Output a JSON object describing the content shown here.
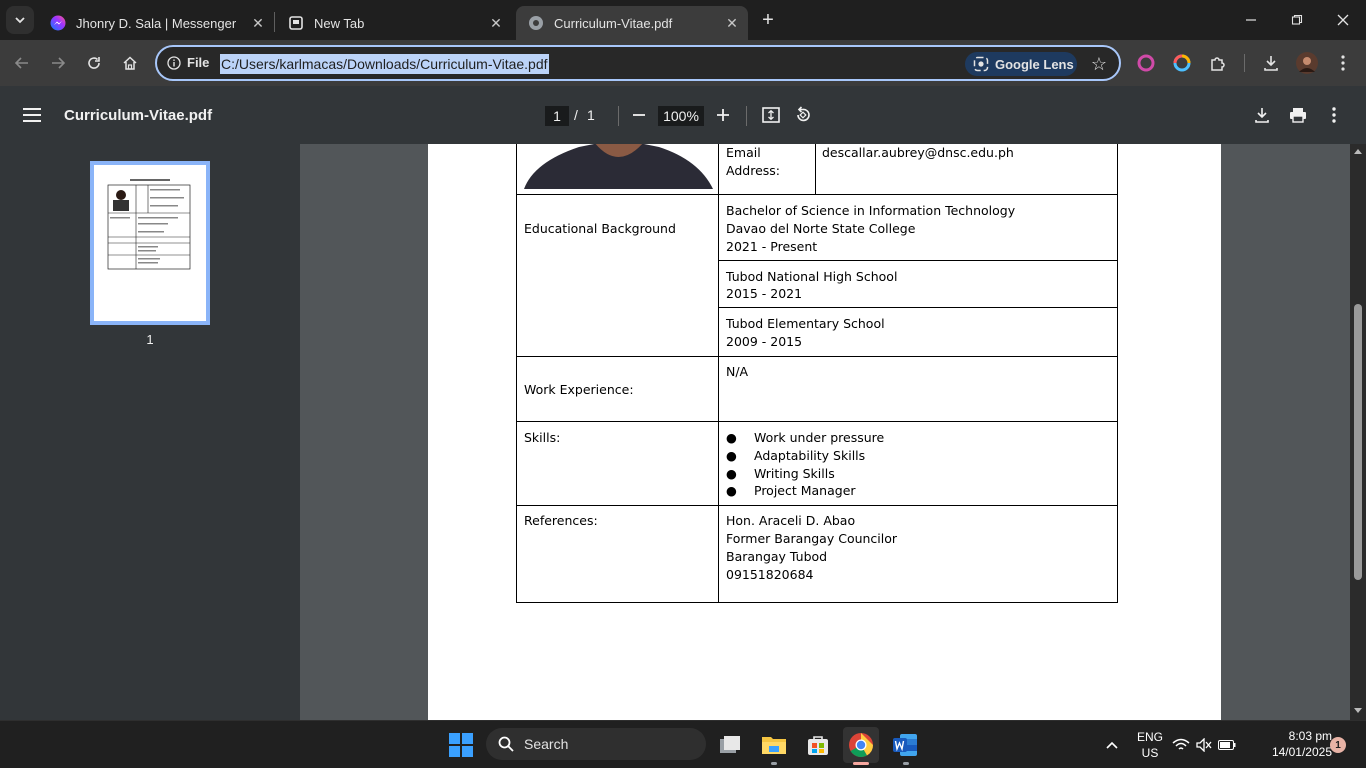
{
  "tabs": [
    {
      "title": "Jhonry D. Sala | Messenger",
      "icon": "messenger-icon"
    },
    {
      "title": "New Tab",
      "icon": "newtab-icon"
    },
    {
      "title": "Curriculum-Vitae.pdf",
      "icon": "globe-icon"
    }
  ],
  "address_bar": {
    "scheme_label": "File",
    "url": "C:/Users/karlmacas/Downloads/Curriculum-Vitae.pdf",
    "lens_label": "Google Lens"
  },
  "pdf_toolbar": {
    "title": "Curriculum-Vitae.pdf",
    "current_page": "1",
    "separator": "/",
    "total_pages": "1",
    "zoom": "100%"
  },
  "thumbnail": {
    "page_number": "1"
  },
  "document": {
    "email_label_1": "Email",
    "email_label_2": "Address:",
    "email_value": "descallar.aubrey@dnsc.edu.ph",
    "education_label": "Educational Background",
    "education": [
      {
        "line1": "Bachelor of Science in Information Technology",
        "line2": "Davao del Norte State College",
        "line3": "2021 - Present"
      },
      {
        "line1": "Tubod National High School",
        "line2": "2015 - 2021"
      },
      {
        "line1": "Tubod Elementary School",
        "line2": "2009 - 2015"
      }
    ],
    "work_label": "Work Experience:",
    "work_value": "N/A",
    "skills_label": "Skills:",
    "skills": [
      "Work under pressure",
      "Adaptability Skills",
      "Writing Skills",
      "Project Manager"
    ],
    "references_label": "References:",
    "references": [
      "Hon. Araceli D. Abao",
      "Former Barangay Councilor",
      "Barangay Tubod",
      "09151820684"
    ]
  },
  "taskbar": {
    "search_label": "Search",
    "lang_1": "ENG",
    "lang_2": "US",
    "time": "8:03 pm",
    "date": "14/01/2025",
    "notification_count": "1"
  }
}
